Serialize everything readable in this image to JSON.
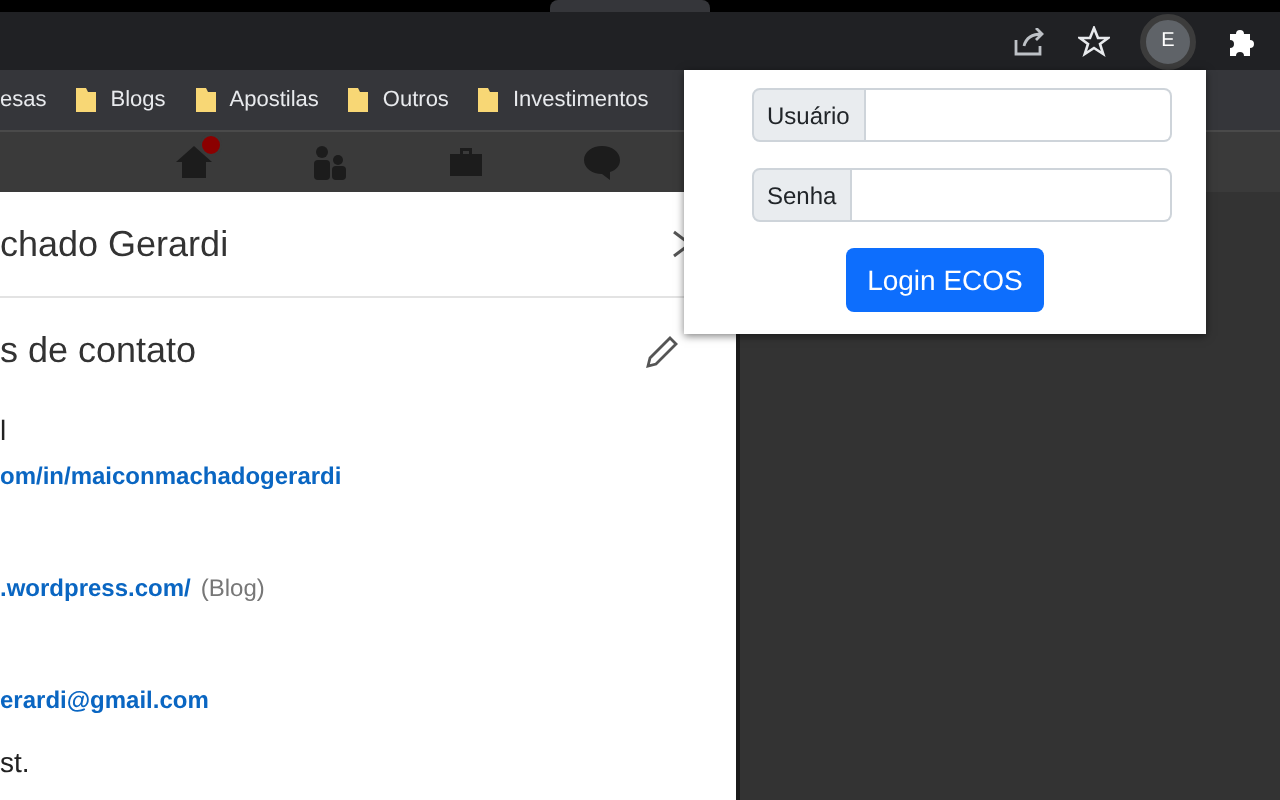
{
  "browser": {
    "avatar": "E"
  },
  "bookmarks": [
    {
      "label": "esas",
      "kind": "plain"
    },
    {
      "label": "Blogs",
      "kind": "folder"
    },
    {
      "label": "Apostilas",
      "kind": "folder"
    },
    {
      "label": "Outros",
      "kind": "folder"
    },
    {
      "label": "Investimentos",
      "kind": "folder"
    }
  ],
  "site_nav": {
    "items": [
      {
        "kind": "home",
        "badge": true
      },
      {
        "kind": "people",
        "badge": false
      },
      {
        "kind": "briefcase",
        "badge": false
      },
      {
        "kind": "chat",
        "badge": false
      }
    ]
  },
  "modal": {
    "title": "chado Gerardi",
    "section_title": "s de contato",
    "entries": [
      {
        "kind": "heading",
        "text": "l"
      },
      {
        "kind": "link",
        "text": "om/in/maiconmachadogerardi"
      },
      {
        "kind": "spacer"
      },
      {
        "kind": "link",
        "text": ".wordpress.com/",
        "note": "(Blog)"
      },
      {
        "kind": "spacer"
      },
      {
        "kind": "link",
        "text": "erardi@gmail.com"
      },
      {
        "kind": "heading",
        "text": "st."
      }
    ]
  },
  "popup": {
    "fields": [
      {
        "label": "Usuário"
      },
      {
        "label": "Senha"
      }
    ],
    "button": "Login ECOS"
  }
}
